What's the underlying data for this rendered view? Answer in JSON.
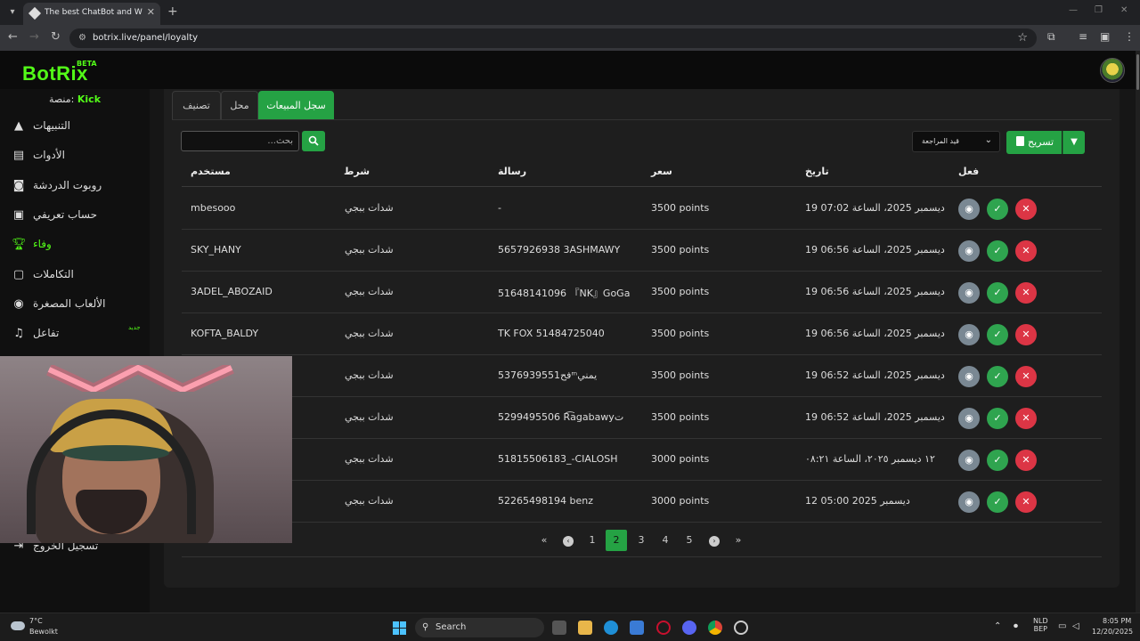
{
  "browser": {
    "tab_title": "The best ChatBot and Widgets",
    "url": "botrix.live/panel/loyalty"
  },
  "app": {
    "logo": "BotRix",
    "beta": "BETA",
    "platform_label": "منصة:",
    "platform_name": "Kick",
    "accent": "#53fc18"
  },
  "sidebar": {
    "items": [
      {
        "label": "التنبيهات",
        "icon": "warning-icon"
      },
      {
        "label": "الأدوات",
        "icon": "widgets-icon"
      },
      {
        "label": "روبوت الدردشة",
        "icon": "robot-icon"
      },
      {
        "label": "حساب تعريفي",
        "icon": "id-card-icon"
      },
      {
        "label": "وفاء",
        "icon": "trophy-icon",
        "active": true
      },
      {
        "label": "التكاملات",
        "icon": "integration-icon"
      },
      {
        "label": "الألعاب المصغرة",
        "icon": "gamepad-icon"
      },
      {
        "label": "تفاعل",
        "icon": "music-icon",
        "badge": "جديد"
      }
    ],
    "logout_label": "تسجيل الخروج"
  },
  "panel": {
    "tabs": [
      "سجل المبيعات",
      "محل",
      "تصنيف"
    ],
    "active_tab": 0,
    "search_placeholder": "بحث...",
    "review_filter": "قيد المراجعة",
    "export_label": "تسريح"
  },
  "table": {
    "headers": {
      "user": "مستخدم",
      "condition": "شرط",
      "message": "رسالة",
      "price": "سعر",
      "date": "تاريخ",
      "action": "فعل"
    },
    "rows": [
      {
        "user": "mbesooo",
        "condition": "شدات ببجي",
        "message": "-",
        "price": "3500 points",
        "date": "19 ديسمبر 2025، الساعة 07:02"
      },
      {
        "user": "SKY_HANY",
        "condition": "شدات ببجي",
        "message": "5657926938 3ASHMAWY",
        "price": "3500 points",
        "date": "19 ديسمبر 2025، الساعة 06:56"
      },
      {
        "user": "3ADEL_ABOZAID",
        "condition": "شدات ببجي",
        "message": "51648141096 『NK』GoGa",
        "price": "3500 points",
        "date": "19 ديسمبر 2025، الساعة 06:56"
      },
      {
        "user": "KOFTA_BALDY",
        "condition": "شدات ببجي",
        "message": "TK FOX 51484725040",
        "price": "3500 points",
        "date": "19 ديسمبر 2025، الساعة 06:56"
      },
      {
        "user": "",
        "condition": "شدات ببجي",
        "message": "فح5376939551ᵐيمني",
        "price": "3500 points",
        "date": "19 ديسمبر 2025، الساعة 06:52"
      },
      {
        "user": "",
        "condition": "شدات ببجي",
        "message": "5299495506 R͡agabawyت",
        "price": "3500 points",
        "date": "19 ديسمبر 2025، الساعة 06:52"
      },
      {
        "user": "",
        "condition": "شدات ببجي",
        "message": "51815506183_-CIALOSH",
        "price": "3000 points",
        "date": "١٢ ديسمبر ٢٠٢٥، الساعة ٠٨:٢١"
      },
      {
        "user": "",
        "condition": "شدات ببجي",
        "message": "52265498194 benz",
        "price": "3000 points",
        "date": "12 ديسمبر 2025 05:00"
      }
    ],
    "action_icons": [
      "eye-icon",
      "check-icon",
      "x-icon"
    ]
  },
  "pagination": {
    "pages": [
      "1",
      "2",
      "3",
      "4",
      "5"
    ],
    "current": "2"
  },
  "taskbar": {
    "temp": "7°C",
    "weather": "Bewolkt",
    "search": "Search",
    "lang_1": "NLD",
    "lang_2": "BEP",
    "time": "8:05 PM",
    "date": "12/20/2025"
  }
}
